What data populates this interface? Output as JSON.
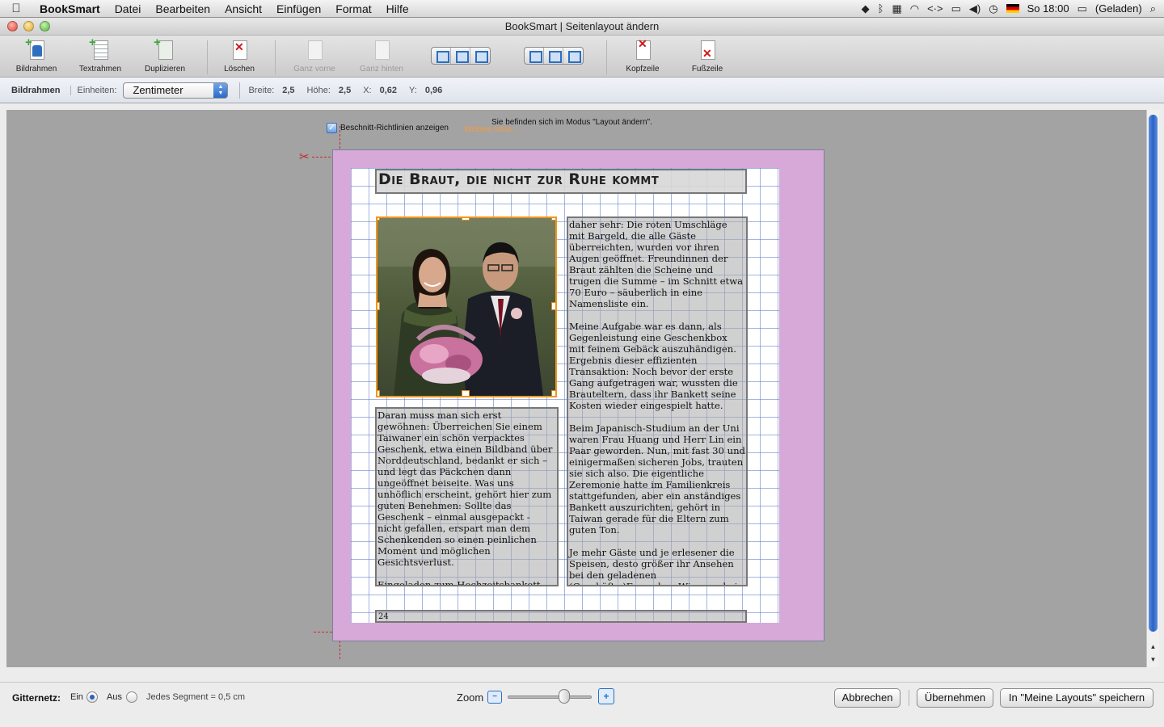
{
  "menubar": {
    "app": "BookSmart",
    "menus": [
      "Datei",
      "Bearbeiten",
      "Ansicht",
      "Einfügen",
      "Format",
      "Hilfe"
    ],
    "clock": "So 18:00",
    "battery": "(Geladen)"
  },
  "window": {
    "title": "BookSmart | Seitenlayout ändern"
  },
  "toolbar": {
    "bildrahmen": "Bildrahmen",
    "textrahmen": "Textrahmen",
    "duplizieren": "Duplizieren",
    "loeschen": "Löschen",
    "ganz_vorne": "Ganz vorne",
    "ganz_hinten": "Ganz hinten",
    "kopfzeile": "Kopfzeile",
    "fusszeile": "Fußzeile"
  },
  "propbar": {
    "selection": "Bildrahmen",
    "units_label": "Einheiten:",
    "units_value": "Zentimeter",
    "breite_label": "Breite:",
    "breite": "2,5",
    "hoehe_label": "Höhe:",
    "hoehe": "2,5",
    "x_label": "X:",
    "x": "0,62",
    "y_label": "Y:",
    "y": "0,96"
  },
  "canvas": {
    "mode_note": "Sie befinden sich im Modus \"Layout ändern\".",
    "trim_label": "Beschnitt-Richtlinien anzeigen",
    "trim_checked": true,
    "more_info": "Weitere Infos ..."
  },
  "page": {
    "title": "Die Braut, die nicht zur Ruhe kommt",
    "left_text": "Daran muss man sich erst gewöhnen: Überreichen Sie einem Taiwaner ein schön verpacktes Geschenk, etwa einen Bildband über Norddeutschland, bedankt er sich – und legt das Päckchen dann ungeöffnet beiseite. Was uns unhöflich erscheint, gehört hier zum guten Benehmen: Sollte das Geschenk – einmal ausgepackt - nicht gefallen, erspart man dem Schenkenden so einen peinlichen Moment und möglichen Gesichtsverlust.\n\nEingeladen zum Hochzeitsbankett eines befreundeten Paares, wunderte ich mich",
    "right_text": "daher sehr: Die roten Umschläge mit Bargeld, die alle Gäste überreichten, wurden vor ihren Augen geöffnet. Freundinnen der Braut zählten die Scheine und trugen die Summe – im Schnitt etwa 70 Euro – säuberlich in eine Namensliste ein.\n\nMeine Aufgabe war es dann, als Gegenleistung eine Geschenkbox mit feinem Gebäck auszuhändigen. Ergebnis dieser effizienten Transaktion: Noch bevor der erste Gang aufgetragen war, wussten die Brauteltern, dass ihr Bankett seine Kosten wieder eingespielt hatte.\n\nBeim Japanisch-Studium an der Uni waren Frau Huang und Herr Lin ein Paar geworden. Nun, mit fast 30 und einigermaßen sicheren Jobs, trauten sie sich also. Die eigentliche Zeremonie hatte im Familienkreis stattgefunden, aber ein anständiges Bankett auszurichten, gehört in Taiwan gerade für die Eltern zum guten Ton.\n\nJe mehr Gäste und je erlesener die Speisen, desto größer ihr Ansehen bei den geladenen (Geschäfts-)Freunden. Wie man bei uns auf dem Dorf den Saal des Gasthofes mietet, so gibt es in",
    "page_number": "24"
  },
  "bottom": {
    "grid_label": "Gitternetz:",
    "on_label": "Ein",
    "off_label": "Aus",
    "grid_on": true,
    "segment_note": "Jedes Segment = 0,5 cm",
    "zoom_label": "Zoom",
    "zoom_level": 0.7,
    "cancel": "Abbrechen",
    "apply": "Übernehmen",
    "save_layout": "In \"Meine Layouts\" speichern"
  },
  "colors": {
    "bleed": "#d7a9d8",
    "grid": "#5a78c8",
    "selection": "#f0961d",
    "trim_line": "#d0262c"
  }
}
